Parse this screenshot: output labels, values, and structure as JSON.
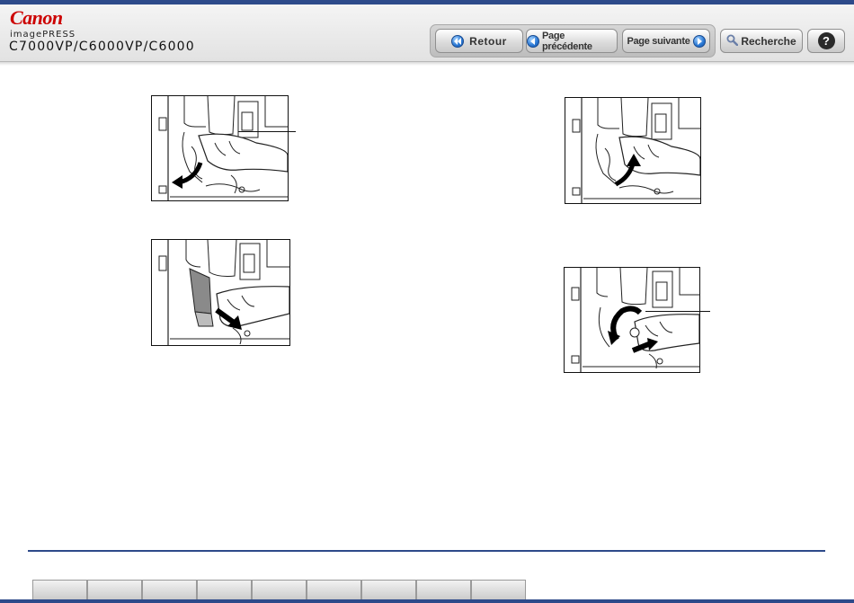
{
  "header": {
    "brand": "Canon",
    "product": "imagePRESS",
    "model": "C7000VP/C6000VP/C6000"
  },
  "nav": {
    "back_label": "Retour",
    "prev_label": "Page précédente",
    "next_label": "Page suivante",
    "search_label": "Recherche",
    "help_label": "?"
  },
  "colors": {
    "accent": "#2d4a8a",
    "brand": "#cc0000",
    "nav_icon": "#2a78d4"
  },
  "icons": {
    "back": "double-chevron-left-icon",
    "prev": "chevron-left-icon",
    "next": "chevron-right-icon",
    "search": "magnifier-icon",
    "help": "question-mark-icon"
  },
  "figures": [
    {
      "name": "figure-step-1",
      "depicts": "hand pulling lever down"
    },
    {
      "name": "figure-step-2",
      "depicts": "hand pushing lever back"
    },
    {
      "name": "figure-step-3",
      "depicts": "hand pulling cartridge out"
    },
    {
      "name": "figure-step-4",
      "depicts": "hand rotating knob"
    }
  ],
  "footer": {
    "tab_count": 9
  }
}
